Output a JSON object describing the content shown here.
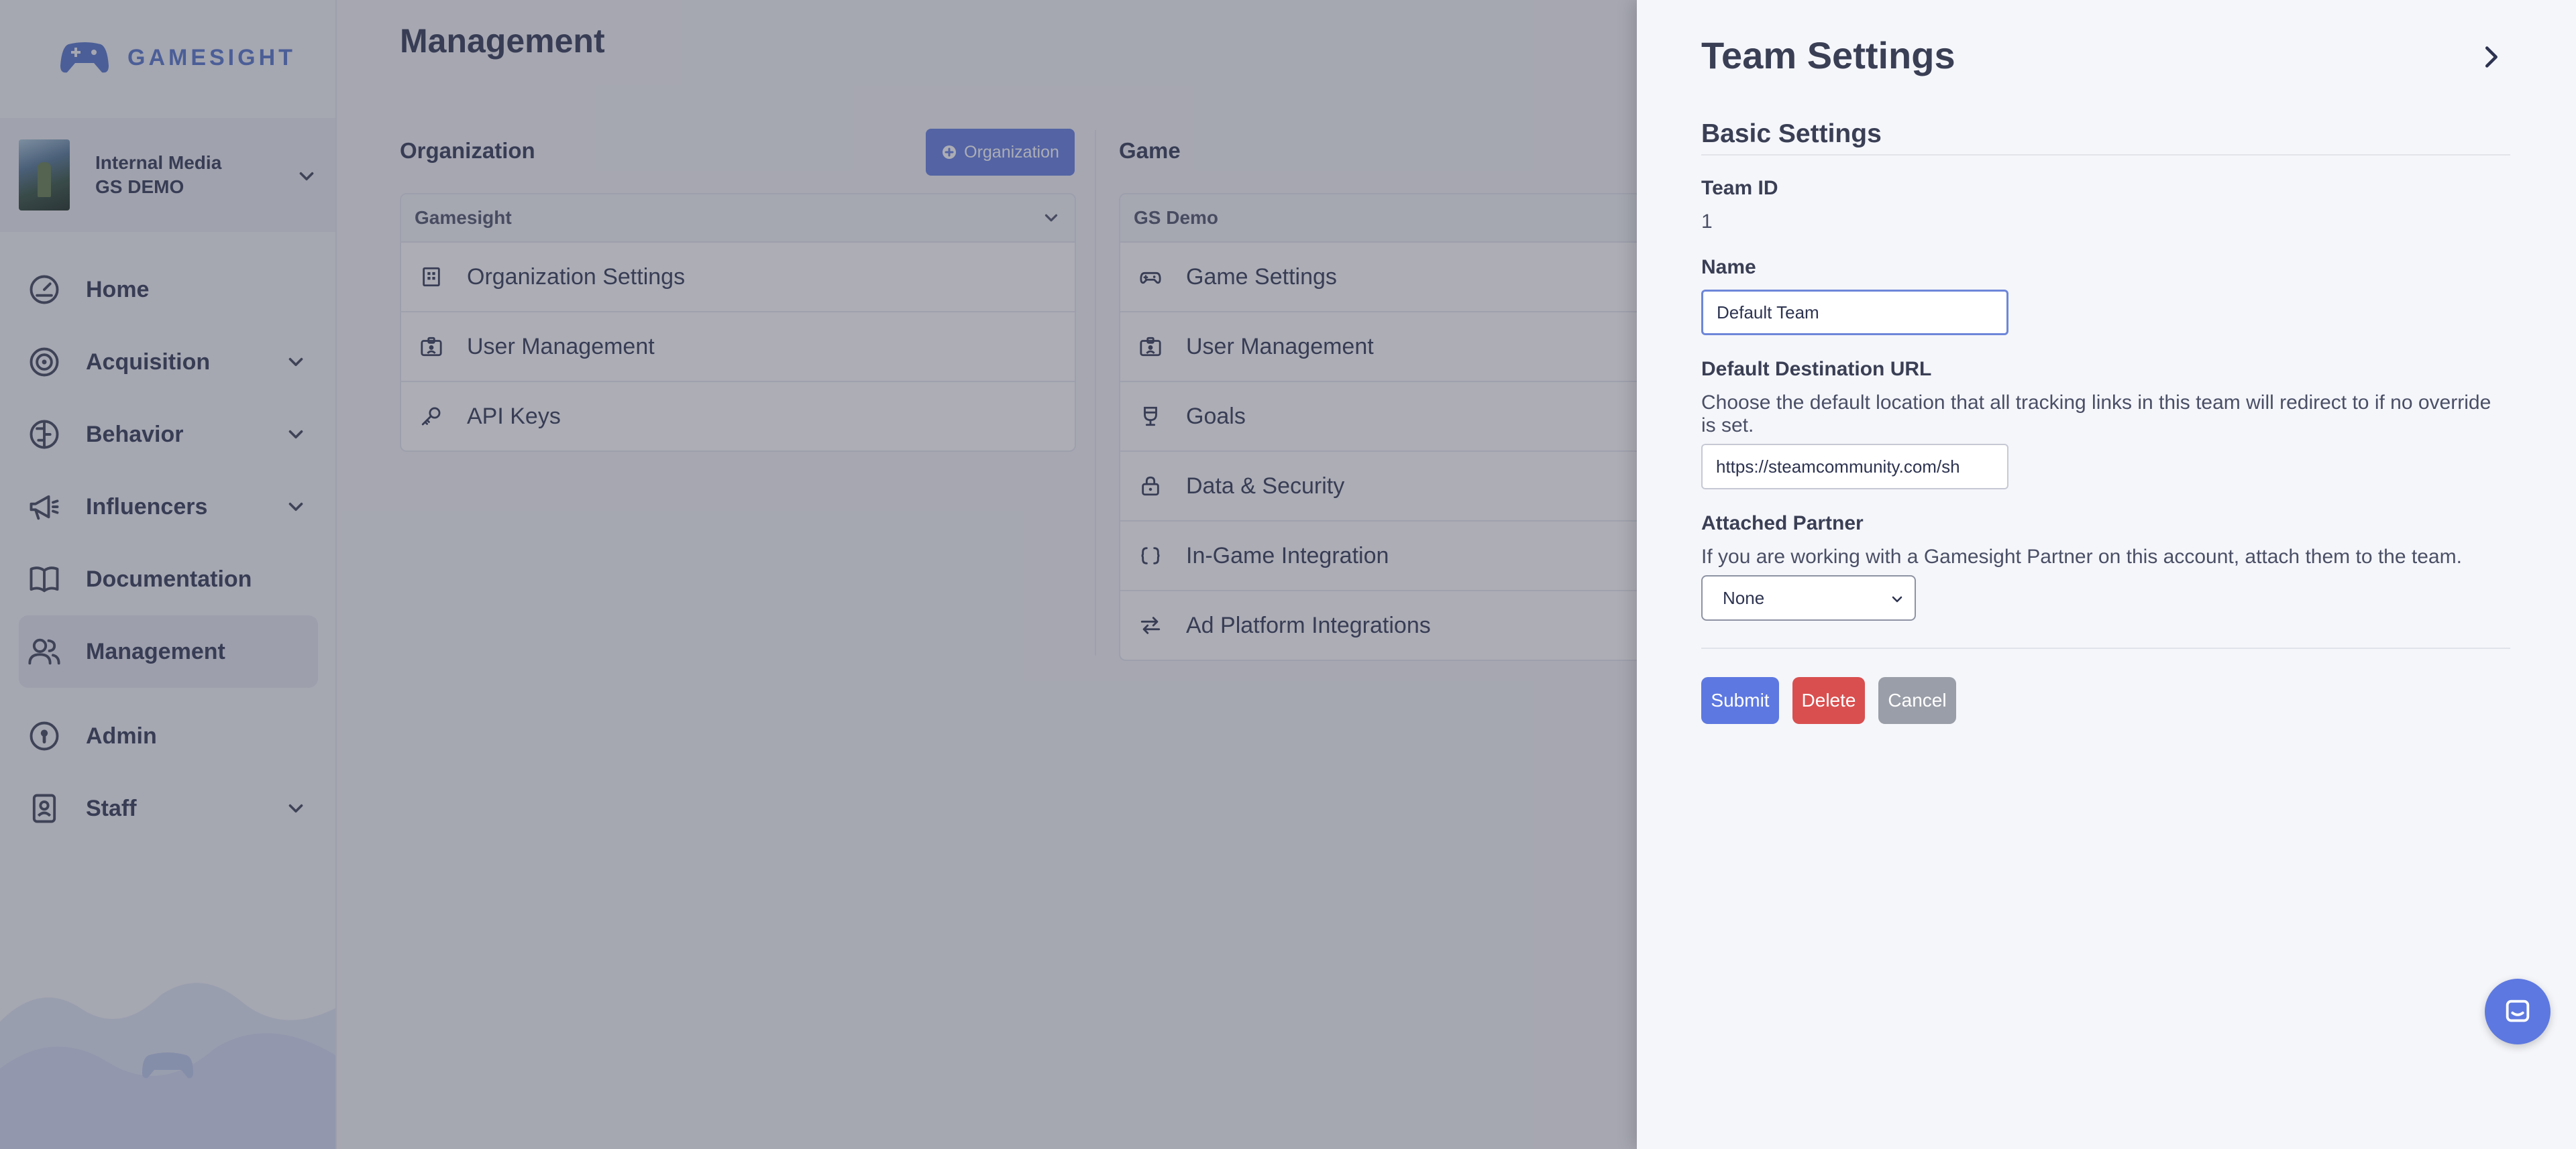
{
  "brand": {
    "name": "GAMESIGHT"
  },
  "account": {
    "line1": "Internal Media",
    "line2": "GS DEMO"
  },
  "nav": {
    "items": [
      {
        "label": "Home"
      },
      {
        "label": "Acquisition"
      },
      {
        "label": "Behavior"
      },
      {
        "label": "Influencers"
      },
      {
        "label": "Documentation"
      },
      {
        "label": "Management"
      },
      {
        "label": "Admin"
      },
      {
        "label": "Staff"
      }
    ]
  },
  "page": {
    "title": "Management"
  },
  "organization": {
    "heading": "Organization",
    "add_button": "Organization",
    "selected": "Gamesight",
    "rows": [
      {
        "label": "Organization Settings"
      },
      {
        "label": "User Management"
      },
      {
        "label": "API Keys"
      }
    ]
  },
  "game": {
    "heading": "Game",
    "selected": "GS Demo",
    "rows": [
      {
        "label": "Game Settings"
      },
      {
        "label": "User Management"
      },
      {
        "label": "Goals"
      },
      {
        "label": "Data & Security"
      },
      {
        "label": "In-Game Integration"
      },
      {
        "label": "Ad Platform Integrations"
      }
    ]
  },
  "drawer": {
    "title": "Team Settings",
    "section": "Basic Settings",
    "team_id_label": "Team ID",
    "team_id_value": "1",
    "name_label": "Name",
    "name_value": "Default Team",
    "url_label": "Default Destination URL",
    "url_help": "Choose the default location that all tracking links in this team will redirect to if no override is set.",
    "url_value": "https://steamcommunity.com/sh",
    "partner_label": "Attached Partner",
    "partner_help": "If you are working with a Gamesight Partner on this account, attach them to the team.",
    "partner_value": "None",
    "submit": "Submit",
    "delete": "Delete",
    "cancel": "Cancel"
  },
  "colors": {
    "accent": "#5d78e0",
    "danger": "#d94f4f",
    "muted": "#9a9ea8"
  }
}
